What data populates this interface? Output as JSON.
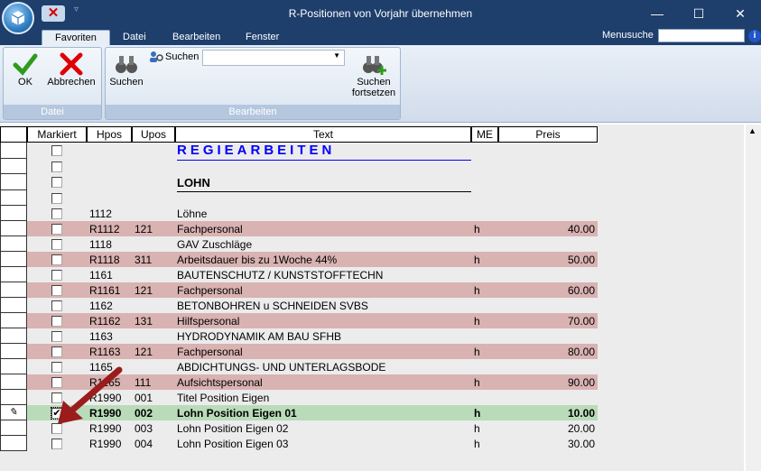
{
  "window": {
    "title": "R-Positionen von Vorjahr übernehmen",
    "minimize": "—",
    "maximize": "☐",
    "close": "✕"
  },
  "tabs": [
    "Favoriten",
    "Datei",
    "Bearbeiten",
    "Fenster"
  ],
  "menusuche": {
    "label": "Menusuche",
    "value": ""
  },
  "ribbon": {
    "ok": "OK",
    "abbrechen": "Abbrechen",
    "group_datei": "Datei",
    "suchen": "Suchen",
    "suchen_small": "Suchen",
    "suchen_fortsetzen": "Suchen\nfortsetzen",
    "group_bearbeiten": "Bearbeiten",
    "combo_value": ""
  },
  "grid": {
    "headers": {
      "markiert": "Markiert",
      "hpos": "Hpos",
      "upos": "Upos",
      "text": "Text",
      "me": "ME",
      "preis": "Preis"
    },
    "rows": [
      {
        "kind": "regie",
        "text": "REGIEARBEITEN"
      },
      {
        "kind": "blank"
      },
      {
        "kind": "lohn",
        "text": "LOHN"
      },
      {
        "kind": "blank"
      },
      {
        "kind": "plain",
        "hpos": "1112",
        "upos": "",
        "text": "Löhne",
        "me": "",
        "preis": ""
      },
      {
        "kind": "pink",
        "hpos": "R1112",
        "upos": "121",
        "text": "Fachpersonal",
        "me": "h",
        "preis": "40.00"
      },
      {
        "kind": "plain",
        "hpos": "1118",
        "upos": "",
        "text": "GAV Zuschläge",
        "me": "",
        "preis": ""
      },
      {
        "kind": "pink",
        "hpos": "R1118",
        "upos": "311",
        "text": "Arbeitsdauer bis zu 1Woche 44%",
        "me": "h",
        "preis": "50.00"
      },
      {
        "kind": "plain",
        "hpos": "1161",
        "upos": "",
        "text": "BAUTENSCHUTZ / KUNSTSTOFFTECHN",
        "me": "",
        "preis": ""
      },
      {
        "kind": "pink",
        "hpos": "R1161",
        "upos": "121",
        "text": "Fachpersonal",
        "me": "h",
        "preis": "60.00"
      },
      {
        "kind": "plain",
        "hpos": "1162",
        "upos": "",
        "text": "BETONBOHREN u SCHNEIDEN  SVBS",
        "me": "",
        "preis": ""
      },
      {
        "kind": "pink",
        "hpos": "R1162",
        "upos": "131",
        "text": "Hilfspersonal",
        "me": "h",
        "preis": "70.00"
      },
      {
        "kind": "plain",
        "hpos": "1163",
        "upos": "",
        "text": "HYDRODYNAMIK AM BAU  SFHB",
        "me": "",
        "preis": ""
      },
      {
        "kind": "pink",
        "hpos": "R1163",
        "upos": "121",
        "text": "Fachpersonal",
        "me": "h",
        "preis": "80.00"
      },
      {
        "kind": "plain",
        "hpos": "1165",
        "upos": "",
        "text": "ABDICHTUNGS- UND UNTERLAGSBODE",
        "me": "",
        "preis": ""
      },
      {
        "kind": "pink",
        "hpos": "R1165",
        "upos": "111",
        "text": "Aufsichtspersonal",
        "me": "h",
        "preis": "90.00"
      },
      {
        "kind": "plain",
        "hpos": "R1990",
        "upos": "001",
        "text": "Titel Position Eigen",
        "me": "",
        "preis": ""
      },
      {
        "kind": "green",
        "hpos": "R1990",
        "upos": "002",
        "text": "Lohn Position Eigen 01",
        "me": "h",
        "preis": "10.00",
        "checked": true,
        "editing": true
      },
      {
        "kind": "plain",
        "hpos": "R1990",
        "upos": "003",
        "text": "Lohn Position Eigen 02",
        "me": "h",
        "preis": "20.00"
      },
      {
        "kind": "plain",
        "hpos": "R1990",
        "upos": "004",
        "text": "Lohn Position Eigen 03",
        "me": "h",
        "preis": "30.00"
      }
    ]
  },
  "colors": {
    "titlebar": "#1e3e6c",
    "pink_row": "#d9b2b2",
    "green_row": "#b9dbb9",
    "arrow": "#9b1c1c"
  }
}
